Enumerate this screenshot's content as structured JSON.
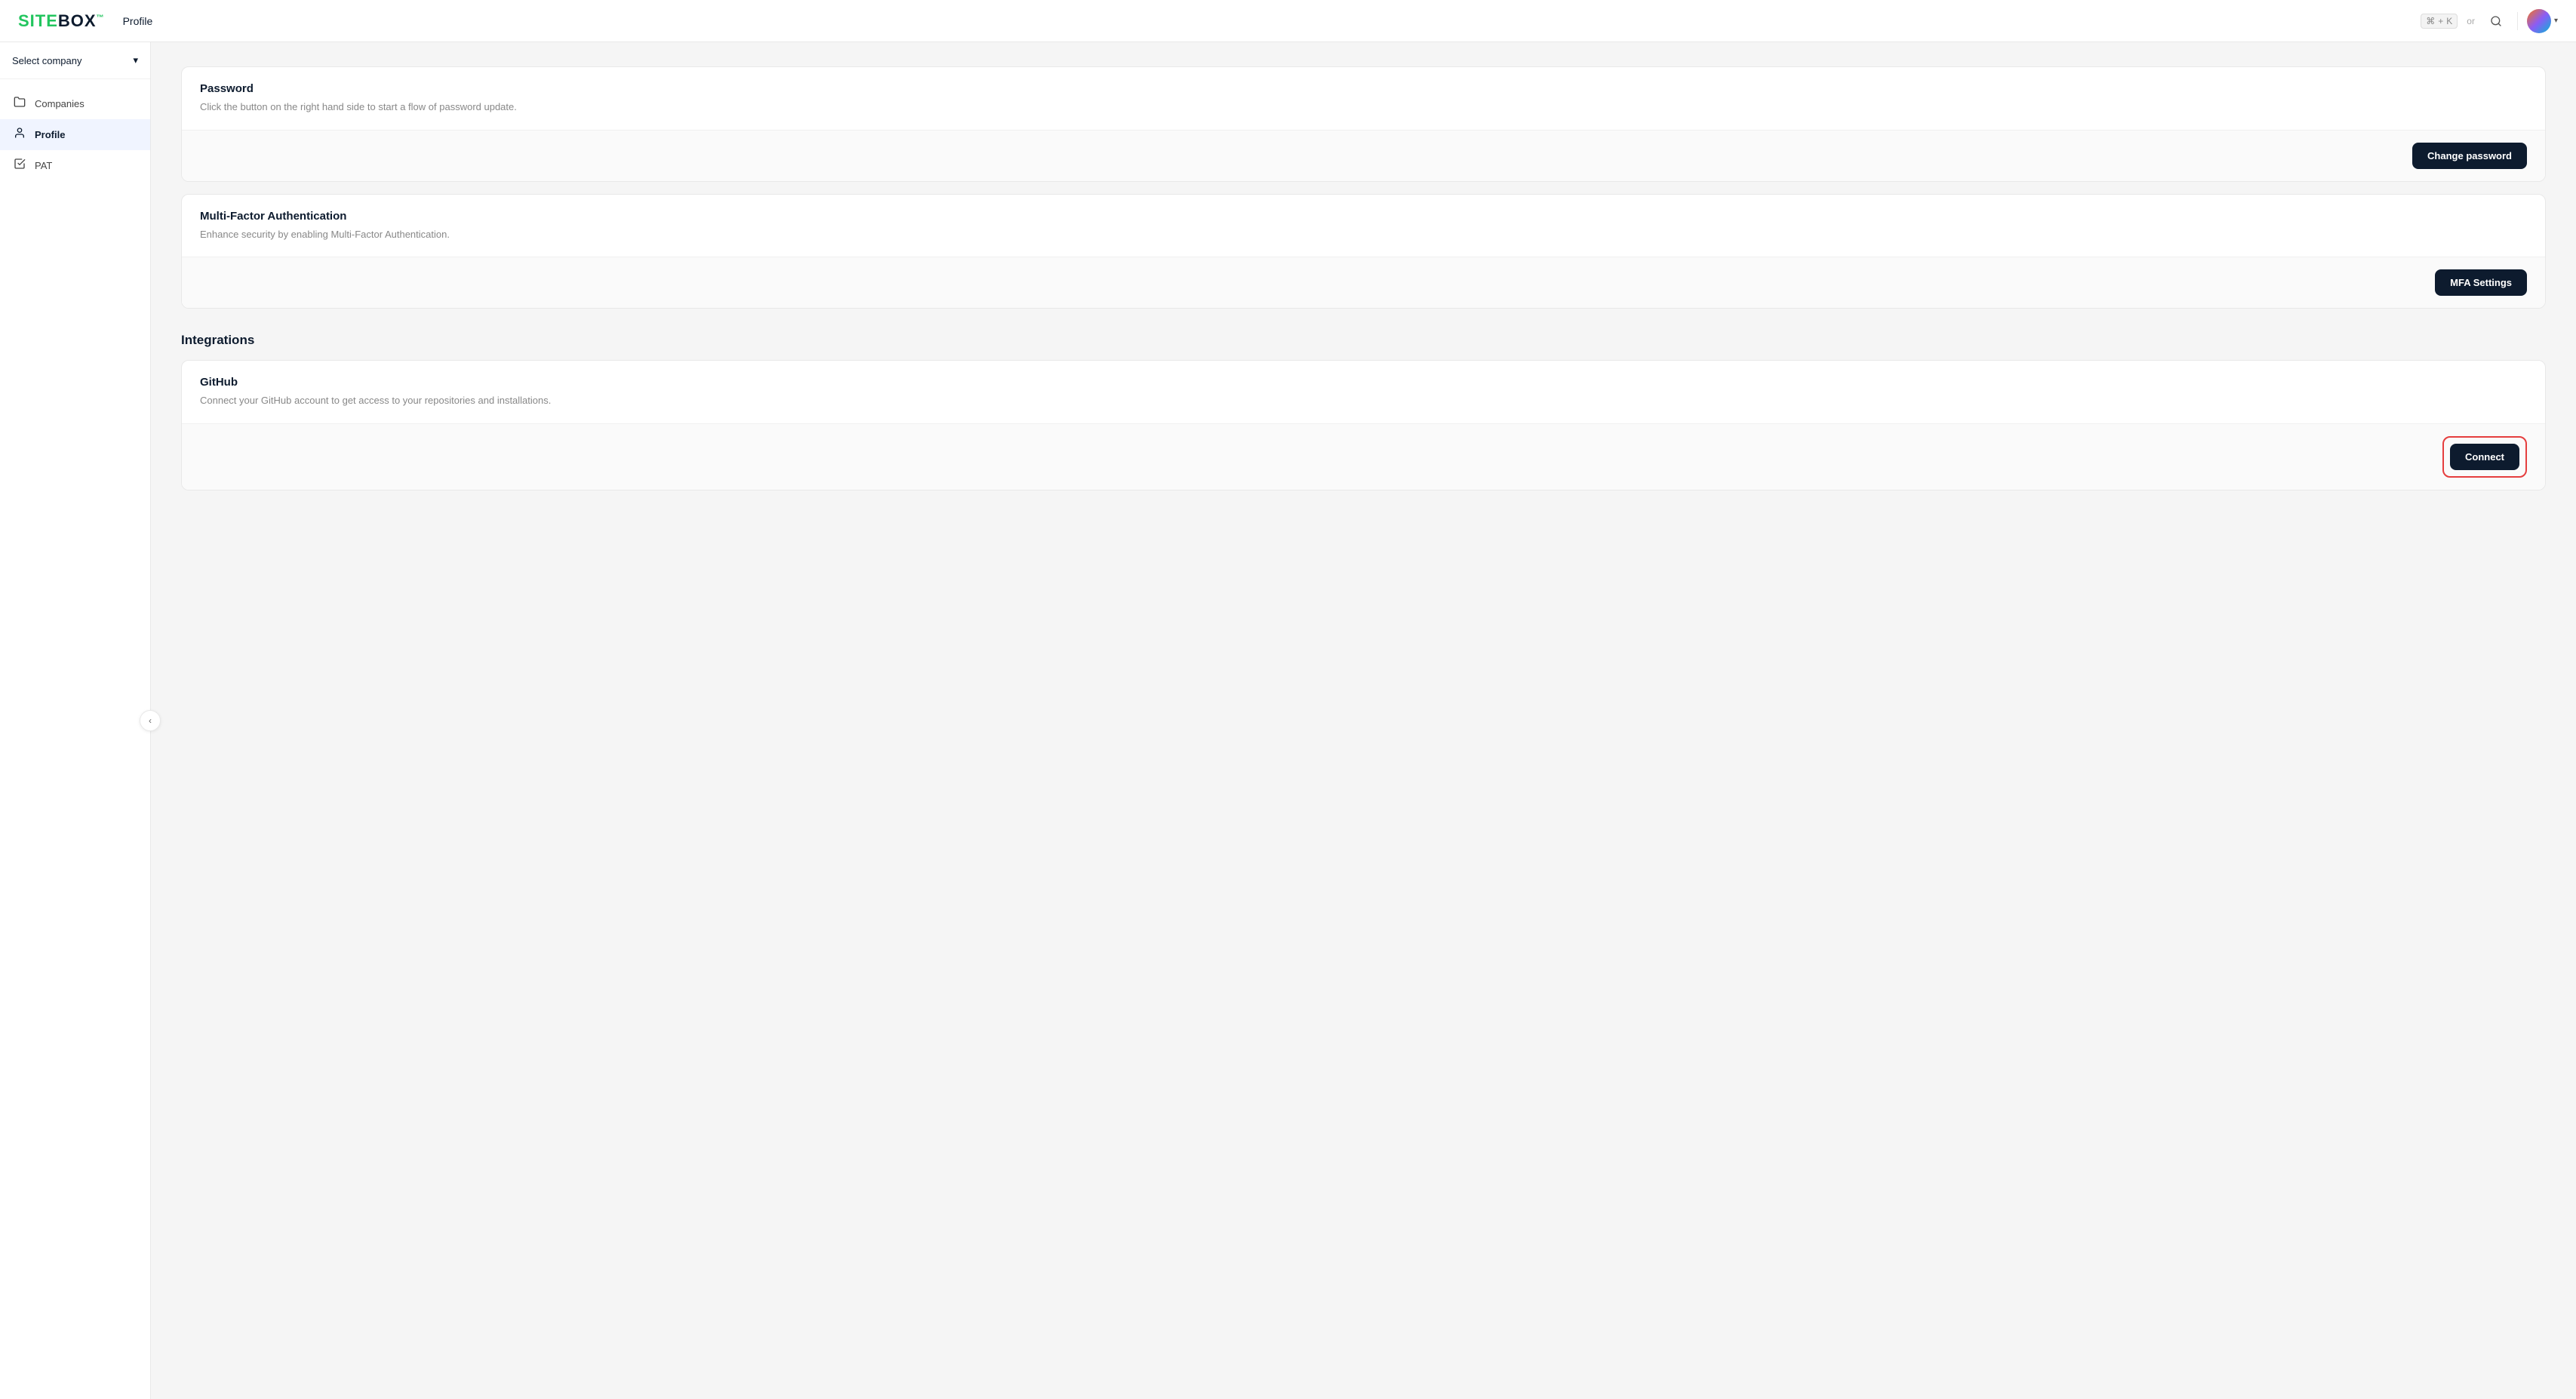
{
  "header": {
    "logo_site": "SITE",
    "logo_box": "BOX",
    "nav_label": "Profile",
    "kbd_cmd": "⌘",
    "kbd_plus": "+",
    "kbd_k": "K",
    "kbd_or": "or"
  },
  "sidebar": {
    "select_company_label": "Select company",
    "items": [
      {
        "id": "companies",
        "label": "Companies",
        "icon": "📁",
        "active": false
      },
      {
        "id": "profile",
        "label": "Profile",
        "icon": "👤",
        "active": true
      },
      {
        "id": "pat",
        "label": "PAT",
        "icon": "✔",
        "active": false
      }
    ],
    "collapse_icon": "‹"
  },
  "main": {
    "password_section": {
      "title": "Password",
      "description": "Click the button on the right hand side to start a flow of password update.",
      "button_label": "Change password"
    },
    "mfa_section": {
      "title": "Multi-Factor Authentication",
      "description": "Enhance security by enabling Multi-Factor Authentication.",
      "button_label": "MFA Settings"
    },
    "integrations_title": "Integrations",
    "github_section": {
      "title": "GitHub",
      "description": "Connect your GitHub account to get access to your repositories and installations.",
      "button_label": "Connect"
    }
  }
}
